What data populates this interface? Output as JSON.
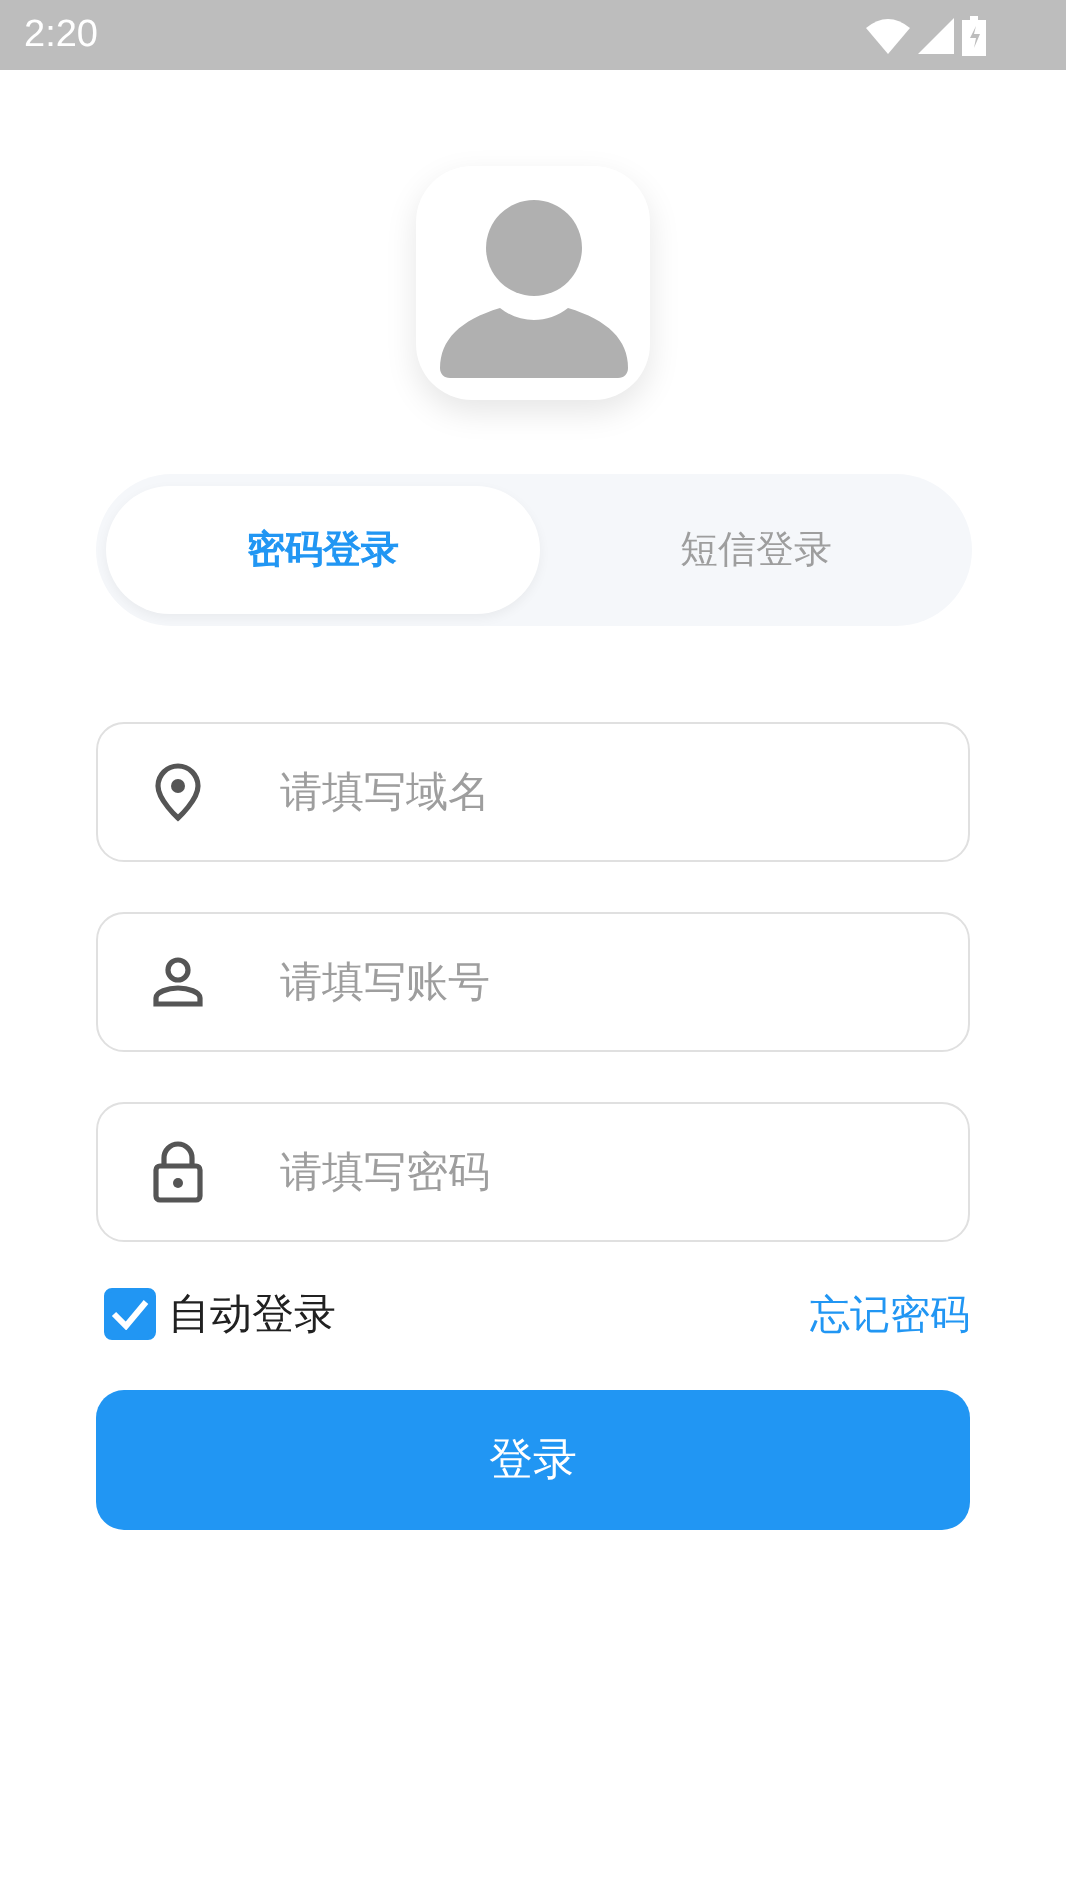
{
  "status_bar": {
    "time": "2:20"
  },
  "tabs": [
    {
      "label": "密码登录",
      "selected": true
    },
    {
      "label": "短信登录",
      "selected": false
    }
  ],
  "fields": [
    {
      "kind": "location",
      "placeholder": "请填写域名"
    },
    {
      "kind": "person",
      "placeholder": "请填写账号"
    },
    {
      "kind": "lock",
      "placeholder": "请填写密码"
    }
  ],
  "auto_login": {
    "label": "自动登录",
    "checked": true
  },
  "forgot_link": "忘记密码",
  "login_button": "登录"
}
